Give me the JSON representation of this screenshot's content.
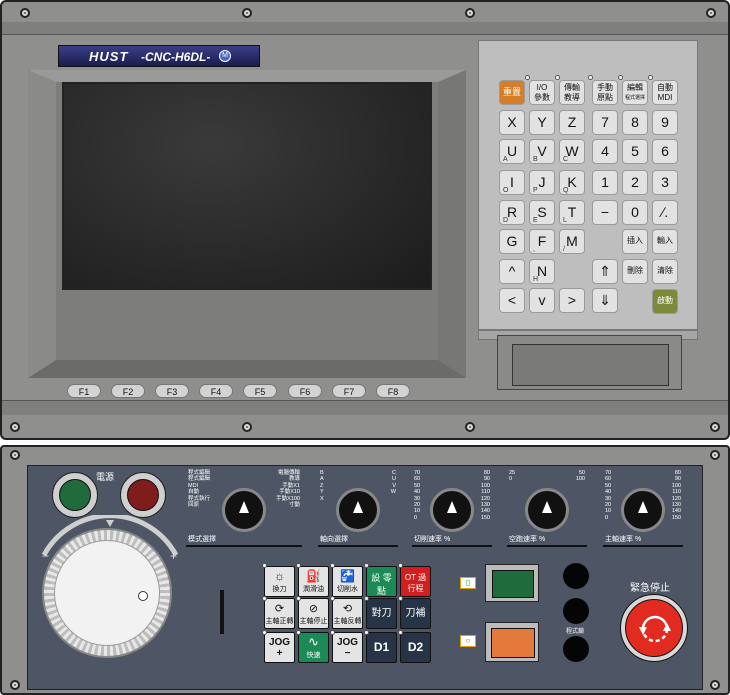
{
  "brand": {
    "logo": "HUST",
    "model": "-CNC-H6DL-",
    "badge": "M"
  },
  "function_keys": [
    "F1",
    "F2",
    "F3",
    "F4",
    "F5",
    "F6",
    "F7",
    "F8"
  ],
  "keypad": {
    "mode_keys": [
      {
        "label": "重置",
        "sub": ""
      },
      {
        "label": "I/O",
        "sub": "參數"
      },
      {
        "label": "傳輸",
        "sub": "教導"
      },
      {
        "label": "手動",
        "sub": "原點"
      },
      {
        "label": "編輯",
        "sub": "程式選擇"
      },
      {
        "label": "自動",
        "sub": "MDI"
      }
    ],
    "letters": [
      {
        "main": "X",
        "sub": ""
      },
      {
        "main": "Y",
        "sub": ""
      },
      {
        "main": "Z",
        "sub": ""
      },
      {
        "main": "U",
        "sub": "A"
      },
      {
        "main": "V",
        "sub": "B"
      },
      {
        "main": "W",
        "sub": "C"
      },
      {
        "main": "I",
        "sub": "O"
      },
      {
        "main": "J",
        "sub": "P"
      },
      {
        "main": "K",
        "sub": "Q"
      },
      {
        "main": "R",
        "sub": "D"
      },
      {
        "main": "S",
        "sub": "E"
      },
      {
        "main": "T",
        "sub": "L"
      },
      {
        "main": "G",
        "sub": ""
      },
      {
        "main": "F",
        "sub": ","
      },
      {
        "main": "M",
        "sub": "/"
      },
      {
        "main": "^",
        "sub": ""
      },
      {
        "main": "N",
        "sub": "H"
      },
      {
        "main": "⇑",
        "sub": ""
      },
      {
        "main": "<",
        "sub": ""
      },
      {
        "main": "v",
        "sub": ""
      },
      {
        "main": ">",
        "sub": ""
      }
    ],
    "numbers": [
      "7",
      "8",
      "9",
      "4",
      "5",
      "6",
      "1",
      "2",
      "3",
      "−",
      "0",
      "∕."
    ],
    "edit_keys": [
      "插入",
      "輸入",
      "刪除",
      "清除"
    ],
    "down2": "⇓",
    "start": "啟動"
  },
  "power": {
    "label": "電源"
  },
  "selectors": [
    {
      "caption": "模式選擇",
      "left": [
        "程式編輯",
        "程式編輯",
        "MDI",
        "自動",
        "程式執行",
        "回原"
      ],
      "right": [
        "電腦傳輸",
        "教導",
        "手動X1",
        "手動X10",
        "手動X100",
        "寸動"
      ]
    },
    {
      "caption": "軸向選擇",
      "left": [
        "B",
        "A",
        "Z",
        "Y",
        "X"
      ],
      "right": [
        "C",
        "U",
        "V",
        "W"
      ]
    },
    {
      "caption": "切削速率 %",
      "left": [
        "70",
        "60",
        "50",
        "40",
        "30",
        "20",
        "10",
        "0"
      ],
      "right": [
        "80",
        "90",
        "100",
        "110",
        "120",
        "130",
        "140",
        "150"
      ]
    },
    {
      "caption": "空跑速率 %",
      "left": [
        "25",
        "0"
      ],
      "right": [
        "50",
        "100"
      ]
    },
    {
      "caption": "主軸速率 %",
      "left": [
        "70",
        "60",
        "50",
        "40",
        "30",
        "20",
        "10",
        "0"
      ],
      "right": [
        "80",
        "90",
        "100",
        "110",
        "120",
        "130",
        "140",
        "150"
      ]
    }
  ],
  "panel_buttons": {
    "tool_change": "換刀",
    "lube": "潤滑油",
    "coolant": "切削水",
    "zero_return": "設 零點",
    "ot_release": "OT 過行程",
    "spindle_cw": "主軸正轉",
    "spindle_stop": "主軸停止",
    "spindle_ccw": "主軸反轉",
    "tool_set": "對刀",
    "tool_comp": "刀補",
    "jog_plus": "JOG +",
    "rapid": "快速",
    "jog_minus": "JOG −",
    "d1": "D1",
    "d2": "D2"
  },
  "program_lock": "程式鎖",
  "estop": "緊急停止",
  "colors": {
    "panel": "#8c8c8a",
    "dark_panel": "#4e5666",
    "keypad_bg": "#bdbdbd",
    "reset": "#d27f2a",
    "start": "#7d8a39",
    "green": "#1f6b3b",
    "orange": "#e37a3c",
    "estop": "#e12a20"
  }
}
